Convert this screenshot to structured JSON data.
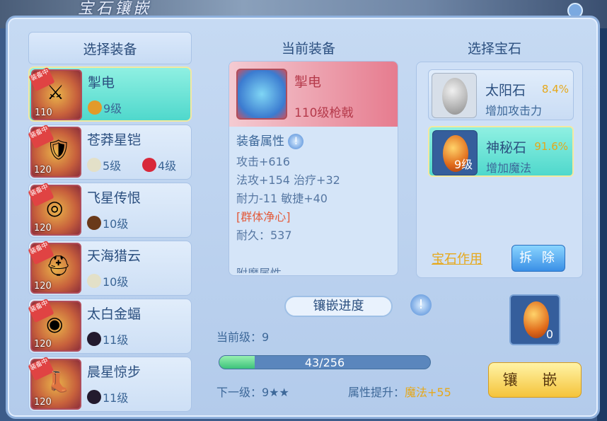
{
  "header": {
    "title": "宝石镶嵌"
  },
  "left": {
    "title": "选择装备",
    "equipped_tag": "装备中",
    "items": [
      {
        "name": "掣电",
        "level": "110",
        "gems": [
          {
            "label": "9级",
            "color": "#e39a2a"
          }
        ]
      },
      {
        "name": "苍莽星铠",
        "level": "120",
        "gems": [
          {
            "label": "5级",
            "color": "#e3e0c8"
          },
          {
            "label": "4级",
            "color": "#d8283a"
          }
        ]
      },
      {
        "name": "飞星传恨",
        "level": "120",
        "gems": [
          {
            "label": "10级",
            "color": "#6a3a1a"
          }
        ]
      },
      {
        "name": "天海猎云",
        "level": "120",
        "gems": [
          {
            "label": "10级",
            "color": "#e3e0c8"
          }
        ]
      },
      {
        "name": "太白金蝠",
        "level": "120",
        "gems": [
          {
            "label": "11级",
            "color": "#231a2e"
          }
        ]
      },
      {
        "name": "晨星惊步",
        "level": "120",
        "gems": [
          {
            "label": "11级",
            "color": "#231a2e"
          }
        ]
      }
    ]
  },
  "current": {
    "title": "当前装备",
    "name": "掣电",
    "sub": "110级枪戟",
    "attr_title": "装备属性",
    "attrs": [
      "攻击+616",
      "法攻+154 治疗+32",
      "耐力-11 敏捷+40",
      "[群体净心]",
      "耐久：537"
    ],
    "enchant_title": "附魔属性"
  },
  "progress": {
    "label": "镶嵌进度",
    "current_level": "当前级：9",
    "bar_text": "43/256",
    "fill": 0.168,
    "next_level": "下一级：9★★",
    "boost_label": "属性提升：",
    "boost_value": "魔法+55"
  },
  "gems": {
    "title": "选择宝石",
    "list": [
      {
        "name": "太阳石",
        "pct": "8.4%",
        "desc": "增加攻击力",
        "count": ""
      },
      {
        "name": "神秘石",
        "pct": "91.6%",
        "desc": "增加魔法",
        "count": "9级"
      }
    ],
    "gem_use": "宝石作用",
    "remove": "拆 除",
    "slot_count": "0",
    "inlay": "镶 嵌"
  },
  "info_icon": "!"
}
